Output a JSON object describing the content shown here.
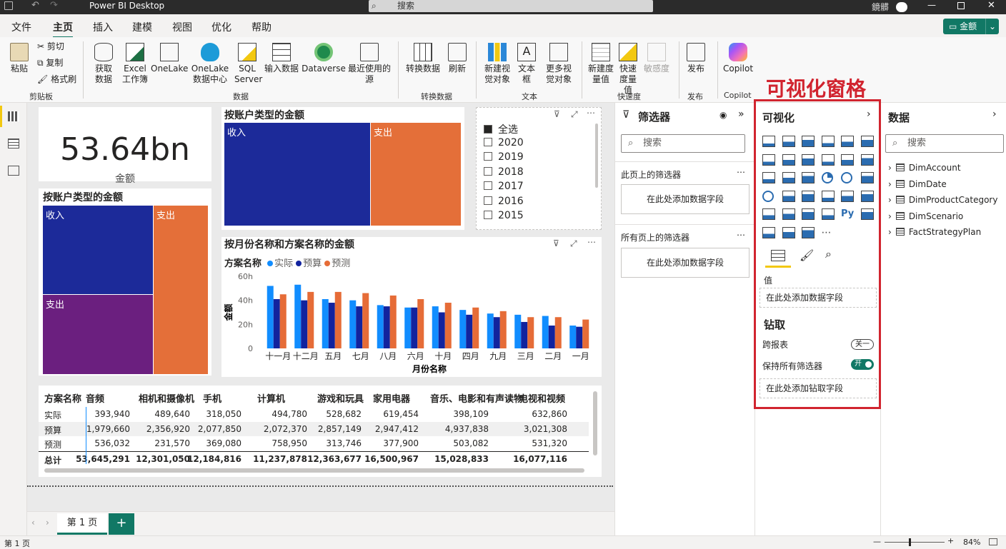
{
  "app": {
    "title": "Power BI Desktop",
    "search_placeholder": "搜索",
    "user": "鏡髒"
  },
  "menu_tabs": [
    "文件",
    "主页",
    "插入",
    "建模",
    "视图",
    "优化",
    "帮助"
  ],
  "share_label": "金额",
  "ribbon": {
    "paste": "粘贴",
    "cut": "剪切",
    "copy": "复制",
    "format_painter": "格式刷",
    "clipboard_group": "剪贴板",
    "get_data": "获取数据",
    "excel": "Excel 工作簿",
    "onelake": "OneLake",
    "onelake_hub": "OneLake 数据中心",
    "sql": "SQL Server",
    "enter_data": "输入数据",
    "dataverse": "Dataverse",
    "recent": "最近使用的源",
    "data_group": "数据",
    "transform": "转换数据",
    "refresh": "刷新",
    "transform_group": "转换数据",
    "new_visual": "新建视觉对象",
    "textbox": "文本框",
    "more_visuals": "更多视觉对象",
    "text_group": "文本",
    "new_measure": "新建度量值",
    "quick_measure": "快速度量值",
    "sensitivity": "敏感度",
    "calc_group": "快速度",
    "publish": "发布",
    "publish_group": "发布",
    "copilot": "Copilot",
    "copilot_group": "Copilot"
  },
  "annotation": "可视化窗格",
  "card": {
    "value": "53.64bn",
    "label": "金额"
  },
  "treemap1": {
    "title": "按账户类型的金额",
    "labels": [
      "收入",
      "支出"
    ]
  },
  "treemap2": {
    "title": "按账户类型的金额",
    "labels": [
      "收入",
      "支出",
      "支出"
    ]
  },
  "slicer": {
    "items": [
      "全选",
      "2020",
      "2019",
      "2018",
      "2017",
      "2016",
      "2015"
    ]
  },
  "chart_data": {
    "type": "bar",
    "title": "按月份名称和方案名称的金额",
    "legend_title": "方案名称",
    "xlabel": "月份名称",
    "ylabel": "金额",
    "yticks": [
      "60h",
      "40h",
      "20h",
      "0"
    ],
    "ylim": [
      0,
      60
    ],
    "categories": [
      "十一月",
      "十二月",
      "五月",
      "七月",
      "八月",
      "六月",
      "十月",
      "四月",
      "九月",
      "三月",
      "二月",
      "一月"
    ],
    "series": [
      {
        "name": "实际",
        "color": "#118dff",
        "values": [
          52,
          53,
          41,
          40,
          36,
          34,
          35,
          32,
          29,
          28,
          27,
          19
        ]
      },
      {
        "name": "预算",
        "color": "#12239e",
        "values": [
          41,
          40,
          38,
          35,
          35,
          34,
          30,
          28,
          26,
          22,
          19,
          18
        ]
      },
      {
        "name": "预测",
        "color": "#e66c37",
        "values": [
          45,
          47,
          47,
          46,
          44,
          41,
          38,
          34,
          31,
          26,
          26,
          24
        ]
      }
    ]
  },
  "matrix": {
    "headers": [
      "方案名称",
      "音频",
      "相机和摄像机",
      "手机",
      "计算机",
      "游戏和玩具",
      "家用电器",
      "音乐、电影和有声读物",
      "电视和视频"
    ],
    "rows": [
      [
        "实际",
        "393,940",
        "489,640",
        "318,050",
        "494,780",
        "528,682",
        "619,454",
        "398,109",
        "632,860"
      ],
      [
        "预算",
        "1,979,660",
        "2,356,920",
        "2,077,850",
        "2,072,370",
        "2,857,149",
        "2,947,412",
        "4,937,838",
        "3,021,308"
      ],
      [
        "预测",
        "536,032",
        "231,570",
        "369,080",
        "758,950",
        "313,746",
        "377,900",
        "503,082",
        "531,320"
      ],
      [
        "总计",
        "53,645,291",
        "12,301,050",
        "12,184,816",
        "11,237,878",
        "12,363,677",
        "16,500,967",
        "15,028,833",
        "16,077,116"
      ]
    ]
  },
  "filters": {
    "title": "筛选器",
    "search": "搜索",
    "page_filters": "此页上的筛选器",
    "all_filters": "所有页上的筛选器",
    "add_field": "在此处添加数据字段"
  },
  "viz": {
    "title": "可视化",
    "values_label": "值",
    "add_field": "在此处添加数据字段",
    "drill_title": "钻取",
    "cross_report": "跨报表",
    "cross_state": "关一",
    "keep_filters": "保持所有筛选器",
    "keep_state": "开",
    "add_drill": "在此处添加钻取字段"
  },
  "data": {
    "title": "数据",
    "search": "搜索",
    "tables": [
      "DimAccount",
      "DimDate",
      "DimProductCategory",
      "DimScenario",
      "FactStrategyPlan"
    ]
  },
  "pages": {
    "page1": "第 1 页",
    "add": "+"
  },
  "status": {
    "page": "第 1 页",
    "zoom": "84%"
  }
}
